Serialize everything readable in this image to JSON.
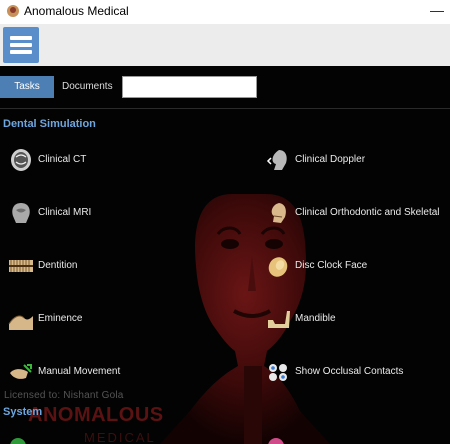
{
  "window": {
    "title": "Anomalous Medical",
    "minimize_glyph": "—"
  },
  "toolbar": {
    "menu_icon": "hamburger-menu-icon"
  },
  "tabs": [
    {
      "label": "Tasks",
      "active": true
    },
    {
      "label": "Documents",
      "active": false
    }
  ],
  "documents_input": {
    "value": "",
    "placeholder": ""
  },
  "sections": [
    {
      "title": "Dental Simulation",
      "items": [
        {
          "label": "Clinical CT",
          "icon": "ct-scan-skull-icon"
        },
        {
          "label": "Clinical Doppler",
          "icon": "doppler-head-icon"
        },
        {
          "label": "Clinical MRI",
          "icon": "mri-head-icon"
        },
        {
          "label": "Clinical Orthodontic and Skeletal",
          "icon": "orthodontic-face-icon"
        },
        {
          "label": "Dentition",
          "icon": "teeth-icon"
        },
        {
          "label": "Disc Clock Face",
          "icon": "disc-icon"
        },
        {
          "label": "Eminence",
          "icon": "eminence-bone-icon"
        },
        {
          "label": "Mandible",
          "icon": "mandible-icon"
        },
        {
          "label": "Manual Movement",
          "icon": "movement-hand-icon"
        },
        {
          "label": "Show Occlusal Contacts",
          "icon": "occlusal-contacts-icon"
        }
      ]
    },
    {
      "title": "System",
      "items": []
    }
  ],
  "footer": {
    "license": "Licensed to: Nishant Gola",
    "brand": "ANOMALOUS",
    "brand_sub": "MEDICAL"
  },
  "colors": {
    "accent": "#4d7fb5",
    "section_title": "#6ea7df",
    "background": "#030303",
    "toolbar": "#ececec"
  }
}
